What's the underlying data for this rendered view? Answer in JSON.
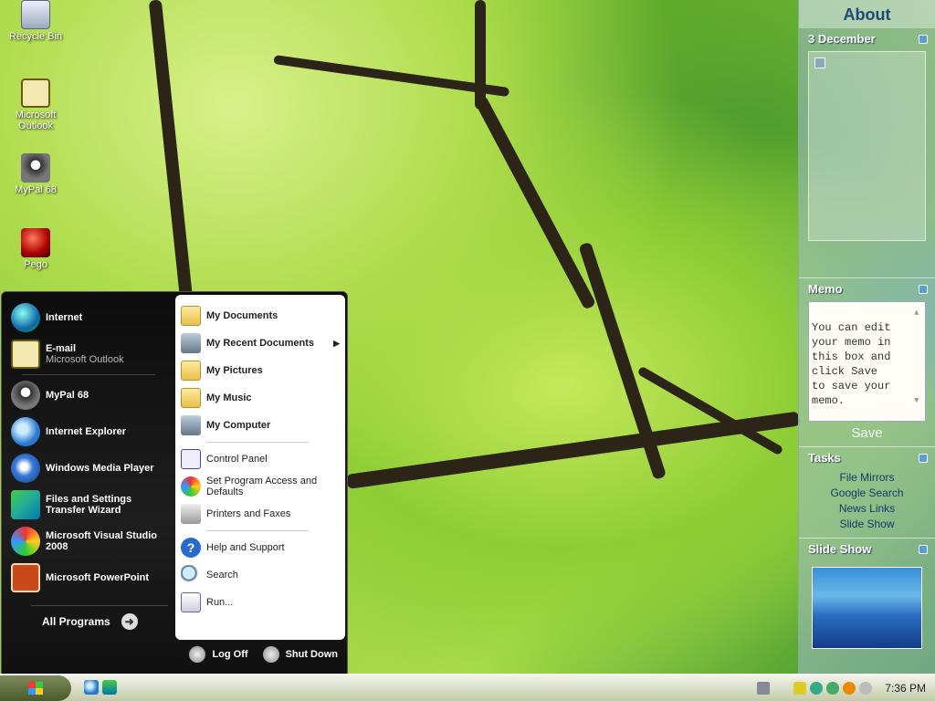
{
  "desktop": {
    "icons": [
      {
        "label": "Recycle Bin",
        "icon": "recycle-bin-icon"
      },
      {
        "label": "Microsoft Outlook",
        "icon": "outlook-icon"
      },
      {
        "label": "MyPal 68",
        "icon": "mypal-icon"
      },
      {
        "label": "Pego",
        "icon": "pego-icon"
      }
    ]
  },
  "sidebar": {
    "title": "About",
    "calendar": {
      "date": "3 December"
    },
    "memo": {
      "heading": "Memo",
      "text": "You can edit\nyour memo in\nthis box and\nclick Save\nto save your\nmemo.",
      "save_label": "Save"
    },
    "tasks": {
      "heading": "Tasks",
      "links": [
        "File Mirrors",
        "Google Search",
        "News Links",
        "Slide Show"
      ]
    },
    "slideshow": {
      "heading": "Slide Show"
    }
  },
  "start_menu": {
    "pinned": [
      {
        "label": "Internet",
        "sub": "",
        "icon": "internet-globe-icon"
      },
      {
        "label": "E-mail",
        "sub": "Microsoft Outlook",
        "icon": "email-icon"
      }
    ],
    "recent": [
      {
        "label": "MyPal 68",
        "icon": "mypal-icon"
      },
      {
        "label": "Internet Explorer",
        "icon": "internet-explorer-icon"
      },
      {
        "label": "Windows Media Player",
        "icon": "media-player-icon"
      },
      {
        "label": "Files and Settings Transfer Wizard",
        "icon": "transfer-wizard-icon"
      },
      {
        "label": "Microsoft Visual Studio 2008",
        "icon": "visual-studio-icon"
      },
      {
        "label": "Microsoft PowerPoint",
        "icon": "powerpoint-icon"
      }
    ],
    "all_programs": "All Programs",
    "places": [
      {
        "label": "My Documents",
        "icon": "documents-folder-icon"
      },
      {
        "label": "My Recent Documents",
        "icon": "recent-documents-icon"
      },
      {
        "label": "My Pictures",
        "icon": "pictures-folder-icon"
      },
      {
        "label": "My Music",
        "icon": "music-folder-icon"
      },
      {
        "label": "My Computer",
        "icon": "computer-icon"
      }
    ],
    "settings": [
      {
        "label": "Control Panel",
        "icon": "control-panel-icon"
      },
      {
        "label": "Set Program Access and Defaults",
        "icon": "program-defaults-icon"
      },
      {
        "label": "Printers and Faxes",
        "icon": "printer-icon"
      }
    ],
    "help": [
      {
        "label": "Help and Support",
        "icon": "help-icon"
      },
      {
        "label": "Search",
        "icon": "search-icon"
      },
      {
        "label": "Run...",
        "icon": "run-icon"
      }
    ],
    "log_off": "Log Off",
    "shut_down": "Shut Down"
  },
  "taskbar": {
    "clock": "7:36 PM"
  }
}
